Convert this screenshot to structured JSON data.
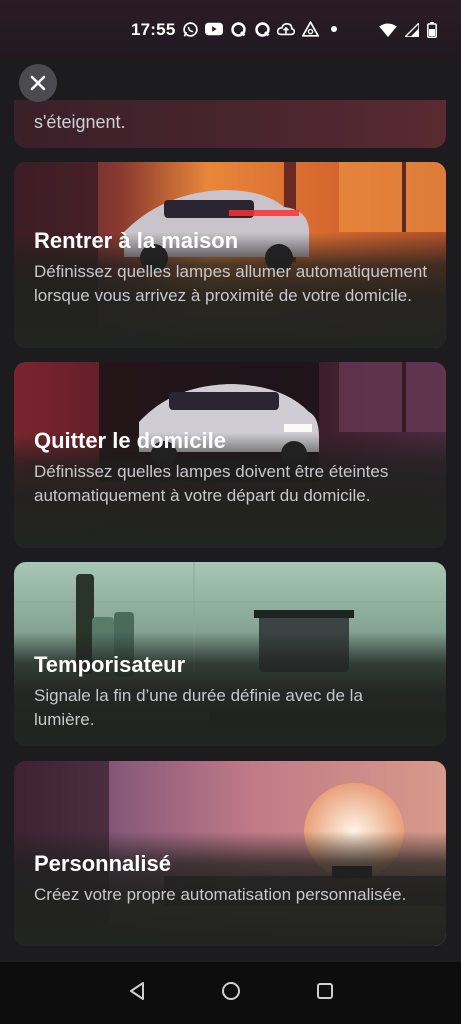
{
  "status_bar": {
    "time": "17:55",
    "icons": [
      "whatsapp-icon",
      "youtube-icon",
      "q-icon",
      "q-icon",
      "cloud-upload-icon",
      "triangle-app-icon",
      "dot-icon"
    ],
    "right_icons": [
      "wifi-icon",
      "signal-icon",
      "battery-icon"
    ]
  },
  "close_icon": "close-icon",
  "partial_card": {
    "text": "s'éteignent."
  },
  "cards": [
    {
      "title": "Rentrer à la maison",
      "description": "Définissez quelles lampes allumer automatiquement lorsque vous arrivez à proximité de votre domicile."
    },
    {
      "title": "Quitter le domicile",
      "description": "Définissez quelles lampes doivent être éteintes automatiquement à votre départ du domicile."
    },
    {
      "title": "Temporisateur",
      "description": "Signale la fin d’une durée définie avec de la lumière."
    },
    {
      "title": "Personnalisé",
      "description": "Créez votre propre automatisation personnalisée."
    }
  ],
  "nav": {
    "icons": [
      "back-icon",
      "home-icon",
      "recents-icon"
    ]
  }
}
